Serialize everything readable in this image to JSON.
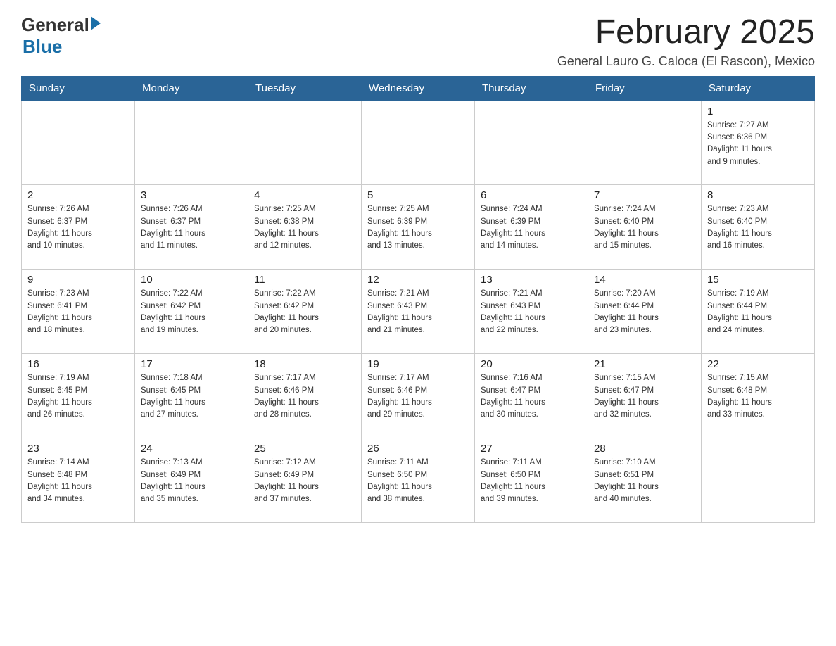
{
  "header": {
    "logo_general": "General",
    "logo_blue": "Blue",
    "month_title": "February 2025",
    "location": "General Lauro G. Caloca (El Rascon), Mexico"
  },
  "weekdays": [
    "Sunday",
    "Monday",
    "Tuesday",
    "Wednesday",
    "Thursday",
    "Friday",
    "Saturday"
  ],
  "weeks": [
    [
      {
        "day": "",
        "info": ""
      },
      {
        "day": "",
        "info": ""
      },
      {
        "day": "",
        "info": ""
      },
      {
        "day": "",
        "info": ""
      },
      {
        "day": "",
        "info": ""
      },
      {
        "day": "",
        "info": ""
      },
      {
        "day": "1",
        "info": "Sunrise: 7:27 AM\nSunset: 6:36 PM\nDaylight: 11 hours\nand 9 minutes."
      }
    ],
    [
      {
        "day": "2",
        "info": "Sunrise: 7:26 AM\nSunset: 6:37 PM\nDaylight: 11 hours\nand 10 minutes."
      },
      {
        "day": "3",
        "info": "Sunrise: 7:26 AM\nSunset: 6:37 PM\nDaylight: 11 hours\nand 11 minutes."
      },
      {
        "day": "4",
        "info": "Sunrise: 7:25 AM\nSunset: 6:38 PM\nDaylight: 11 hours\nand 12 minutes."
      },
      {
        "day": "5",
        "info": "Sunrise: 7:25 AM\nSunset: 6:39 PM\nDaylight: 11 hours\nand 13 minutes."
      },
      {
        "day": "6",
        "info": "Sunrise: 7:24 AM\nSunset: 6:39 PM\nDaylight: 11 hours\nand 14 minutes."
      },
      {
        "day": "7",
        "info": "Sunrise: 7:24 AM\nSunset: 6:40 PM\nDaylight: 11 hours\nand 15 minutes."
      },
      {
        "day": "8",
        "info": "Sunrise: 7:23 AM\nSunset: 6:40 PM\nDaylight: 11 hours\nand 16 minutes."
      }
    ],
    [
      {
        "day": "9",
        "info": "Sunrise: 7:23 AM\nSunset: 6:41 PM\nDaylight: 11 hours\nand 18 minutes."
      },
      {
        "day": "10",
        "info": "Sunrise: 7:22 AM\nSunset: 6:42 PM\nDaylight: 11 hours\nand 19 minutes."
      },
      {
        "day": "11",
        "info": "Sunrise: 7:22 AM\nSunset: 6:42 PM\nDaylight: 11 hours\nand 20 minutes."
      },
      {
        "day": "12",
        "info": "Sunrise: 7:21 AM\nSunset: 6:43 PM\nDaylight: 11 hours\nand 21 minutes."
      },
      {
        "day": "13",
        "info": "Sunrise: 7:21 AM\nSunset: 6:43 PM\nDaylight: 11 hours\nand 22 minutes."
      },
      {
        "day": "14",
        "info": "Sunrise: 7:20 AM\nSunset: 6:44 PM\nDaylight: 11 hours\nand 23 minutes."
      },
      {
        "day": "15",
        "info": "Sunrise: 7:19 AM\nSunset: 6:44 PM\nDaylight: 11 hours\nand 24 minutes."
      }
    ],
    [
      {
        "day": "16",
        "info": "Sunrise: 7:19 AM\nSunset: 6:45 PM\nDaylight: 11 hours\nand 26 minutes."
      },
      {
        "day": "17",
        "info": "Sunrise: 7:18 AM\nSunset: 6:45 PM\nDaylight: 11 hours\nand 27 minutes."
      },
      {
        "day": "18",
        "info": "Sunrise: 7:17 AM\nSunset: 6:46 PM\nDaylight: 11 hours\nand 28 minutes."
      },
      {
        "day": "19",
        "info": "Sunrise: 7:17 AM\nSunset: 6:46 PM\nDaylight: 11 hours\nand 29 minutes."
      },
      {
        "day": "20",
        "info": "Sunrise: 7:16 AM\nSunset: 6:47 PM\nDaylight: 11 hours\nand 30 minutes."
      },
      {
        "day": "21",
        "info": "Sunrise: 7:15 AM\nSunset: 6:47 PM\nDaylight: 11 hours\nand 32 minutes."
      },
      {
        "day": "22",
        "info": "Sunrise: 7:15 AM\nSunset: 6:48 PM\nDaylight: 11 hours\nand 33 minutes."
      }
    ],
    [
      {
        "day": "23",
        "info": "Sunrise: 7:14 AM\nSunset: 6:48 PM\nDaylight: 11 hours\nand 34 minutes."
      },
      {
        "day": "24",
        "info": "Sunrise: 7:13 AM\nSunset: 6:49 PM\nDaylight: 11 hours\nand 35 minutes."
      },
      {
        "day": "25",
        "info": "Sunrise: 7:12 AM\nSunset: 6:49 PM\nDaylight: 11 hours\nand 37 minutes."
      },
      {
        "day": "26",
        "info": "Sunrise: 7:11 AM\nSunset: 6:50 PM\nDaylight: 11 hours\nand 38 minutes."
      },
      {
        "day": "27",
        "info": "Sunrise: 7:11 AM\nSunset: 6:50 PM\nDaylight: 11 hours\nand 39 minutes."
      },
      {
        "day": "28",
        "info": "Sunrise: 7:10 AM\nSunset: 6:51 PM\nDaylight: 11 hours\nand 40 minutes."
      },
      {
        "day": "",
        "info": ""
      }
    ]
  ]
}
